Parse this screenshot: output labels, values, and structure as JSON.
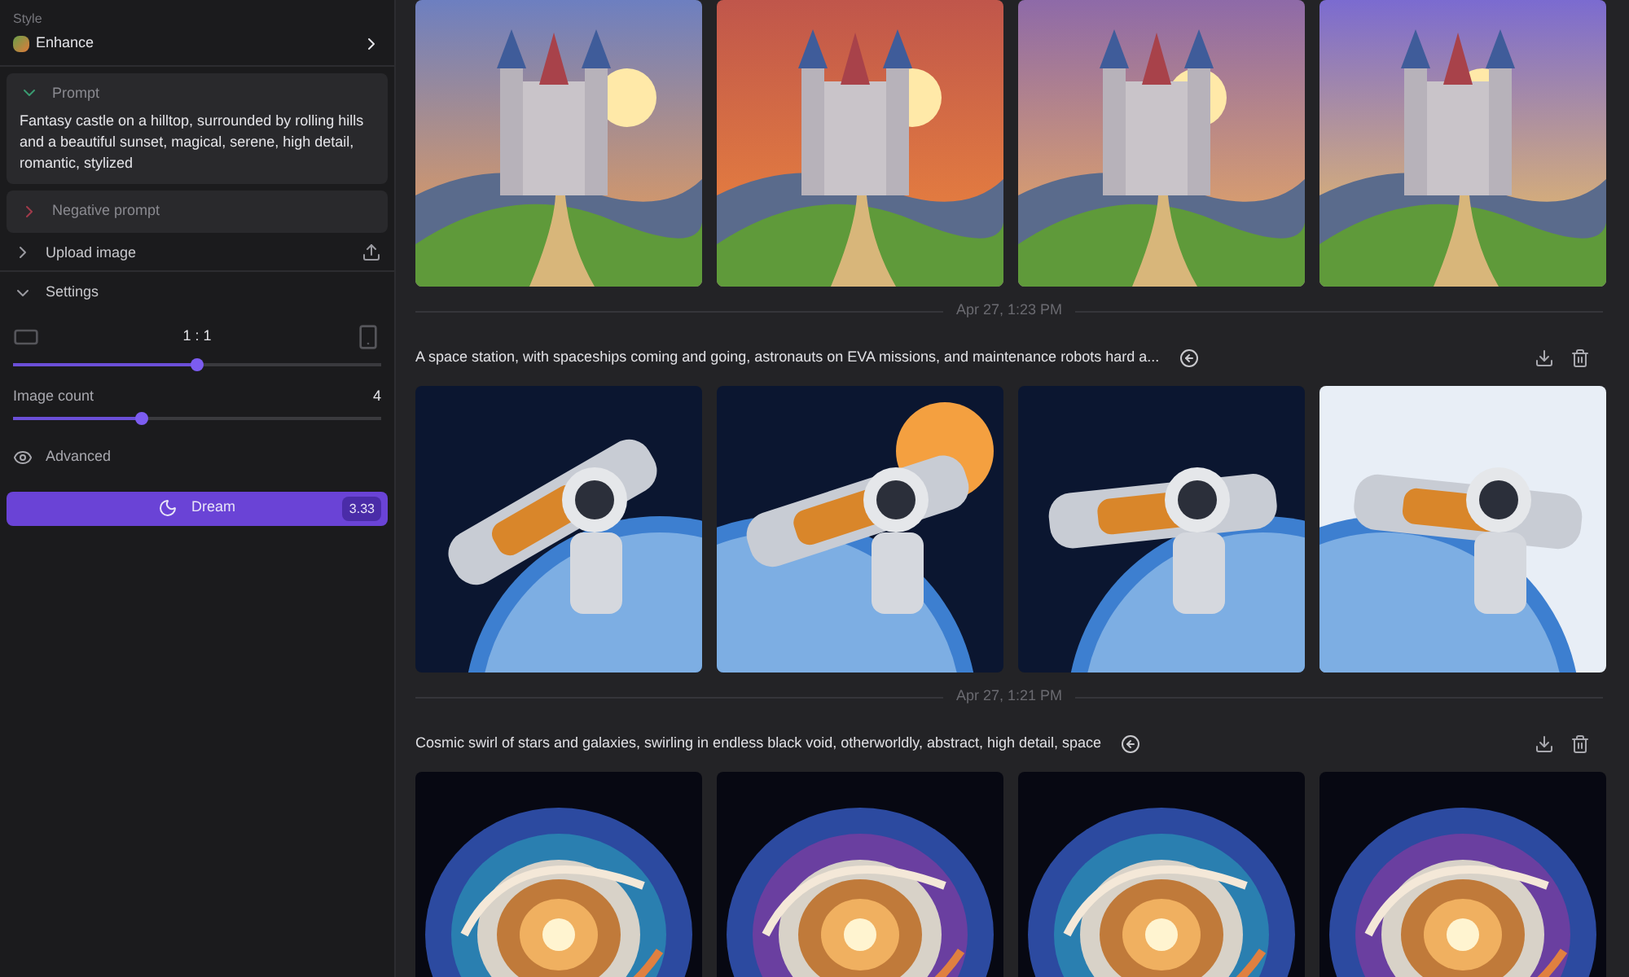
{
  "sidebar": {
    "style": {
      "label": "Style",
      "value": "Enhance"
    },
    "prompt": {
      "label": "Prompt",
      "expanded": true,
      "text": "Fantasy castle on a hilltop, surrounded by rolling hills and a beautiful sunset, magical, serene, high detail, romantic, stylized"
    },
    "negative_prompt": {
      "label": "Negative prompt",
      "expanded": false
    },
    "upload": {
      "label": "Upload image",
      "expanded": false
    },
    "settings": {
      "label": "Settings",
      "expanded": true,
      "aspect": {
        "reading": "1 : 1",
        "level": 0.5
      },
      "count": {
        "label": "Image count",
        "reading": "4",
        "level": 0.35
      },
      "advanced": "Advanced"
    },
    "dream": {
      "label": "Dream",
      "cost": "3.33"
    }
  },
  "groups": [
    {
      "images": [
        {
          "kind": "picture"
        },
        {
          "kind": "picture"
        },
        {
          "kind": "picture"
        },
        {
          "kind": "picture"
        }
      ]
    },
    {
      "date": "Apr 27, 1:23 PM",
      "prompt": "A space station, with spaceships coming and going, astronauts on EVA missions, and maintenance robots hard a...",
      "images": [
        {
          "kind": "picture"
        },
        {
          "kind": "picture"
        },
        {
          "kind": "picture"
        },
        {
          "kind": "picture"
        }
      ]
    },
    {
      "date": "Apr 27, 1:21 PM",
      "prompt": "Cosmic swirl of stars and galaxies, swirling in endless black void, otherworldly, abstract, high detail, space",
      "images": [
        {
          "kind": "picture"
        },
        {
          "kind": "picture"
        },
        {
          "kind": "picture"
        },
        {
          "kind": "picture"
        }
      ]
    }
  ]
}
